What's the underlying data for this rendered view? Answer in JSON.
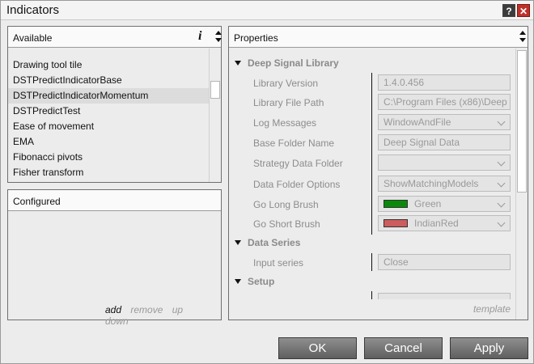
{
  "window": {
    "title": "Indicators",
    "help_label": "?",
    "close_label": "✕"
  },
  "available": {
    "header": "Available",
    "info_label": "i",
    "items": [
      "Drawing tool tile",
      "DSTPredictIndicatorBase",
      "DSTPredictIndicatorMomentum",
      "DSTPredictTest",
      "Ease of movement",
      "EMA",
      "Fibonacci pivots",
      "Fisher transform"
    ],
    "selected_index": 2
  },
  "configured": {
    "header": "Configured",
    "actions": {
      "add": "add",
      "remove": "remove",
      "up": "up",
      "down": "down"
    }
  },
  "properties": {
    "header": "Properties",
    "template_label": "template",
    "categories": {
      "deep_signal": "Deep Signal Library",
      "data_series": "Data Series",
      "setup": "Setup"
    },
    "rows": {
      "library_version": {
        "label": "Library Version",
        "value": "1.4.0.456"
      },
      "library_path": {
        "label": "Library File Path",
        "value": "C:\\Program Files (x86)\\Deep"
      },
      "log_messages": {
        "label": "Log Messages",
        "value": "WindowAndFile"
      },
      "base_folder": {
        "label": "Base Folder Name",
        "value": "Deep Signal Data"
      },
      "strategy_folder": {
        "label": "Strategy Data Folder",
        "value": ""
      },
      "data_folder_options": {
        "label": "Data Folder Options",
        "value": "ShowMatchingModels"
      },
      "go_long": {
        "label": "Go Long Brush",
        "value": "Green",
        "color": "#0a8a0a"
      },
      "go_short": {
        "label": "Go Short Brush",
        "value": "IndianRed",
        "color": "#cd5c5c"
      },
      "input_series": {
        "label": "Input series",
        "value": "Close"
      }
    }
  },
  "buttons": {
    "ok": "OK",
    "cancel": "Cancel",
    "apply": "Apply"
  }
}
